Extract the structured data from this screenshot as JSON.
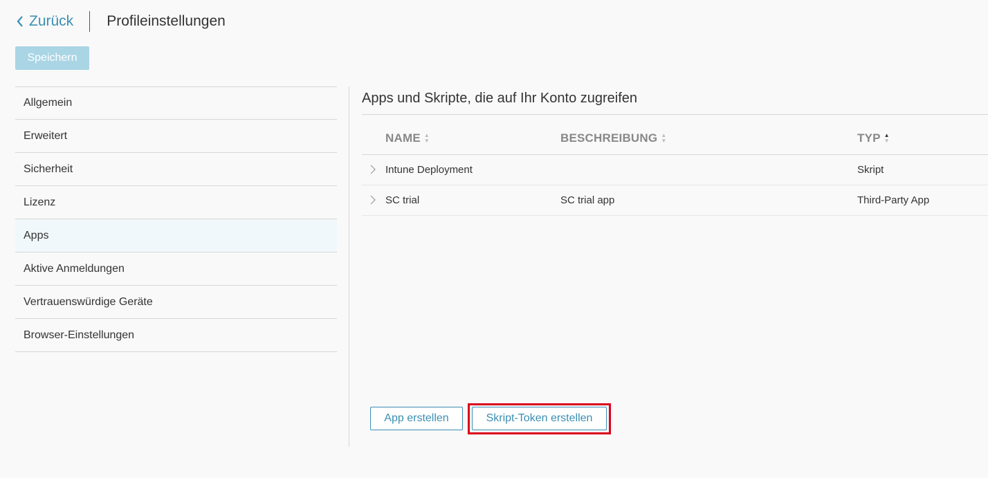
{
  "header": {
    "back_label": "Zurück",
    "title": "Profileinstellungen"
  },
  "toolbar": {
    "save_label": "Speichern"
  },
  "sidebar": {
    "items": [
      {
        "label": "Allgemein"
      },
      {
        "label": "Erweitert"
      },
      {
        "label": "Sicherheit"
      },
      {
        "label": "Lizenz"
      },
      {
        "label": "Apps",
        "active": true
      },
      {
        "label": "Aktive Anmeldungen"
      },
      {
        "label": "Vertrauenswürdige Geräte"
      },
      {
        "label": "Browser-Einstellungen"
      }
    ]
  },
  "main": {
    "section_title": "Apps und Skripte, die auf Ihr Konto zugreifen",
    "table": {
      "columns": [
        {
          "label": "NAME"
        },
        {
          "label": "BESCHREIBUNG"
        },
        {
          "label": "TYP"
        }
      ],
      "rows": [
        {
          "name": "Intune Deployment",
          "description": "",
          "type": "Skript"
        },
        {
          "name": "SC trial",
          "description": "SC trial app",
          "type": "Third-Party App"
        }
      ]
    },
    "buttons": {
      "create_app": "App erstellen",
      "create_token": "Skript-Token erstellen"
    }
  },
  "colors": {
    "accent": "#3b8fb3",
    "save_disabled": "#a9d5e5",
    "highlight": "#d9001b"
  }
}
